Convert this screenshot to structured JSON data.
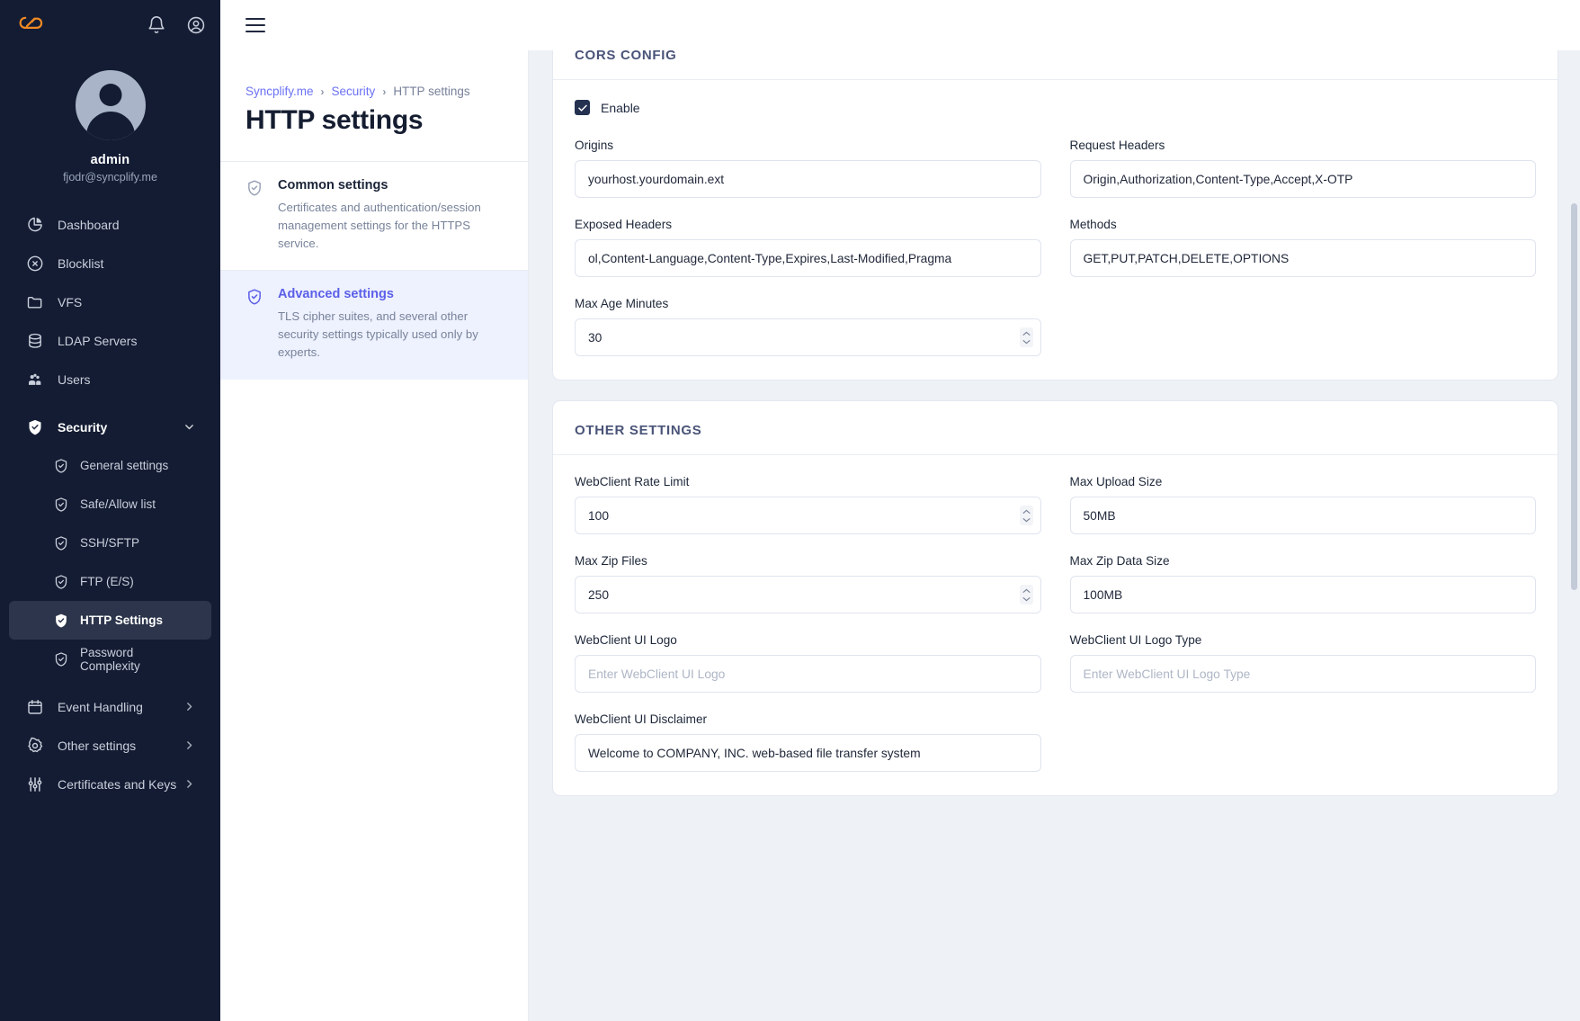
{
  "sidebar": {
    "logo_icon": "syncplify-cloud-logo",
    "top_icons": [
      {
        "name": "notifications-bell-icon"
      },
      {
        "name": "account-circle-icon"
      }
    ],
    "user": {
      "name": "admin",
      "email": "fjodr@syncplify.me"
    },
    "items": [
      {
        "label": "Dashboard",
        "icon": "pie-chart-icon",
        "level": 0,
        "state": "normal",
        "chevron": ""
      },
      {
        "label": "Blocklist",
        "icon": "block-circle-icon",
        "level": 0,
        "state": "normal",
        "chevron": ""
      },
      {
        "label": "VFS",
        "icon": "folder-icon",
        "level": 0,
        "state": "normal",
        "chevron": ""
      },
      {
        "label": "LDAP Servers",
        "icon": "database-icon",
        "level": 0,
        "state": "normal",
        "chevron": ""
      },
      {
        "label": "Users",
        "icon": "users-icon",
        "level": 0,
        "state": "normal",
        "chevron": ""
      },
      {
        "label": "Security",
        "icon": "shield-check-icon",
        "level": 0,
        "state": "expanded",
        "chevron": "down"
      },
      {
        "label": "General settings",
        "icon": "shield-check-icon",
        "level": 1,
        "state": "normal",
        "chevron": ""
      },
      {
        "label": "Safe/Allow list",
        "icon": "shield-check-icon",
        "level": 1,
        "state": "normal",
        "chevron": ""
      },
      {
        "label": "SSH/SFTP",
        "icon": "shield-check-icon",
        "level": 1,
        "state": "normal",
        "chevron": ""
      },
      {
        "label": "FTP (E/S)",
        "icon": "shield-check-icon",
        "level": 1,
        "state": "normal",
        "chevron": ""
      },
      {
        "label": "HTTP Settings",
        "icon": "shield-check-icon",
        "level": 1,
        "state": "active",
        "chevron": ""
      },
      {
        "label": "Password Complexity",
        "icon": "shield-check-icon",
        "level": 1,
        "state": "normal",
        "chevron": ""
      },
      {
        "label": "Event Handling",
        "icon": "calendar-icon",
        "level": 0,
        "state": "normal",
        "chevron": "right"
      },
      {
        "label": "Other settings",
        "icon": "gear-icon",
        "level": 0,
        "state": "normal",
        "chevron": "right"
      },
      {
        "label": "Certificates and Keys",
        "icon": "sliders-icon",
        "level": 0,
        "state": "normal",
        "chevron": "right"
      }
    ]
  },
  "topbar": {
    "menu_icon": "hamburger-menu-icon"
  },
  "breadcrumb": {
    "items": [
      "Syncplify.me",
      "Security",
      "HTTP settings"
    ],
    "separator": "›"
  },
  "page": {
    "title": "HTTP settings"
  },
  "settings_options": [
    {
      "title": "Common settings",
      "description": "Certificates and authentication/session management settings for the HTTPS service.",
      "icon": "shield-check-icon",
      "selected": false
    },
    {
      "title": "Advanced settings",
      "description": "TLS cipher suites, and several other security settings typically used only by experts.",
      "icon": "shield-check-icon",
      "selected": true
    }
  ],
  "cors_config": {
    "heading": "CORS CONFIG",
    "enable": {
      "label": "Enable",
      "checked": true,
      "icon": "checkmark-icon"
    },
    "fields": {
      "origins": {
        "label": "Origins",
        "value": "yourhost.yourdomain.ext"
      },
      "request_headers": {
        "label": "Request Headers",
        "value": "Origin,Authorization,Content-Type,Accept,X-OTP"
      },
      "exposed_headers": {
        "label": "Exposed Headers",
        "value": "ol,Content-Language,Content-Type,Expires,Last-Modified,Pragma"
      },
      "methods": {
        "label": "Methods",
        "value": "GET,PUT,PATCH,DELETE,OPTIONS"
      },
      "max_age_minutes": {
        "label": "Max Age Minutes",
        "value": "30",
        "stepper": true
      }
    }
  },
  "other_settings": {
    "heading": "OTHER SETTINGS",
    "fields": {
      "webclient_rate_limit": {
        "label": "WebClient Rate Limit",
        "value": "100",
        "stepper": true
      },
      "max_upload_size": {
        "label": "Max Upload Size",
        "value": "50MB"
      },
      "max_zip_files": {
        "label": "Max Zip Files",
        "value": "250",
        "stepper": true
      },
      "max_zip_data_size": {
        "label": "Max Zip Data Size",
        "value": "100MB"
      },
      "webclient_ui_logo": {
        "label": "WebClient UI Logo",
        "value": "",
        "placeholder": "Enter WebClient UI Logo"
      },
      "webclient_ui_logo_type": {
        "label": "WebClient UI Logo Type",
        "value": "",
        "placeholder": "Enter WebClient UI Logo Type"
      },
      "webclient_ui_disclaimer": {
        "label": "WebClient UI Disclaimer",
        "value": "Welcome to COMPANY, INC. web-based file transfer system"
      }
    }
  },
  "colors": {
    "sidebar_bg": "#131c33",
    "accent": "#6b72f5",
    "logo_orange": "#f08a24",
    "heading": "#4a5478",
    "page_bg": "#eef1f6"
  }
}
